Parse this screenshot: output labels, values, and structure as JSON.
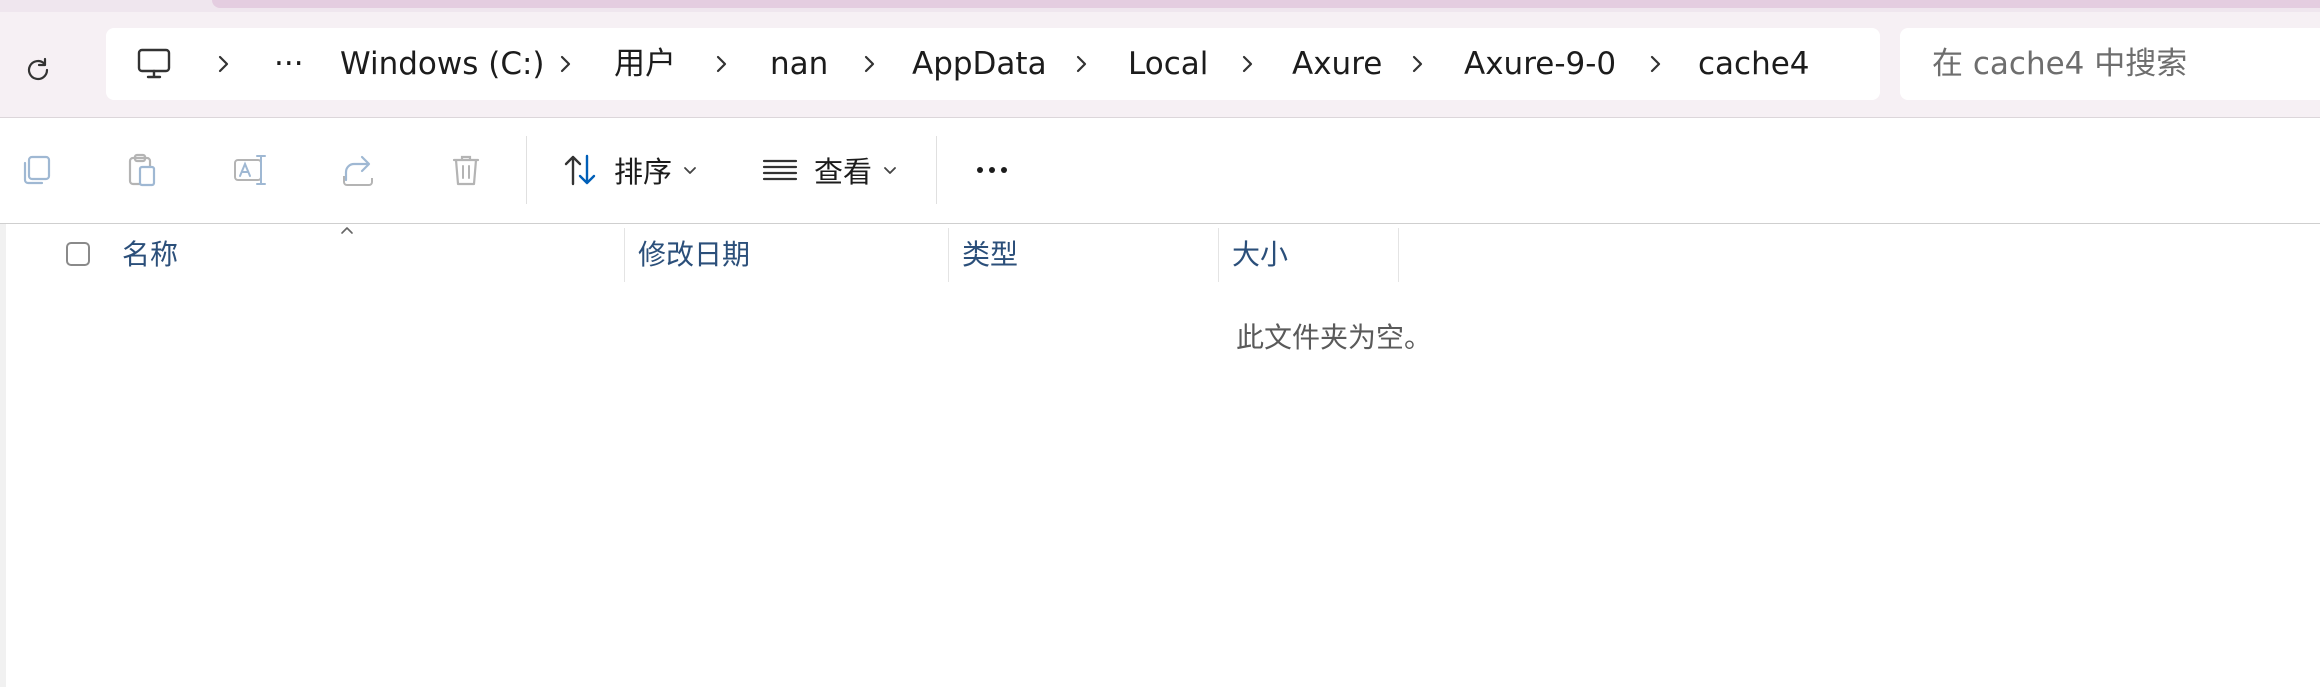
{
  "address_bar": {
    "breadcrumbs": [
      {
        "label": "Windows (C:)"
      },
      {
        "label": "用户"
      },
      {
        "label": "nan"
      },
      {
        "label": "AppData"
      },
      {
        "label": "Local"
      },
      {
        "label": "Axure"
      },
      {
        "label": "Axure-9-0"
      },
      {
        "label": "cache4"
      }
    ],
    "overflow_label": "···"
  },
  "search": {
    "placeholder": "在 cache4 中搜索"
  },
  "command_bar": {
    "sort_label": "排序",
    "view_label": "查看",
    "more_label": "···",
    "icons": [
      "copy-icon",
      "paste-icon",
      "rename-icon",
      "share-icon",
      "delete-icon"
    ]
  },
  "columns": {
    "name": "名称",
    "modified": "修改日期",
    "type": "类型",
    "size": "大小"
  },
  "empty_message": "此文件夹为空。",
  "colors": {
    "accent": "#005fb8",
    "header_text": "#2b4f7a",
    "disabled_icon": "#9fb8d3"
  }
}
